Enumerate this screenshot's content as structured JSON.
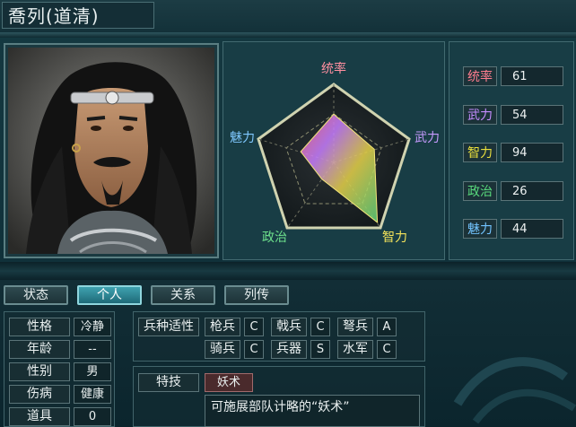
{
  "character": {
    "name": "喬列(道清)"
  },
  "radar": {
    "labels": {
      "command": "统率",
      "war": "武力",
      "intelligence": "智力",
      "politics": "政治",
      "charm": "魅力"
    },
    "colors": {
      "command": "#ff8fa0",
      "war": "#c79bff",
      "intelligence": "#f2e25a",
      "politics": "#6de08c",
      "charm": "#7fc8ff"
    }
  },
  "stats": [
    {
      "label": "统率",
      "value": "61",
      "color": "#ff7d8e"
    },
    {
      "label": "武力",
      "value": "54",
      "color": "#c58cff"
    },
    {
      "label": "智力",
      "value": "94",
      "color": "#eadf3c"
    },
    {
      "label": "政治",
      "value": "26",
      "color": "#58d97c"
    },
    {
      "label": "魅力",
      "value": "44",
      "color": "#72c4ff"
    }
  ],
  "tabs": [
    {
      "label": "状态",
      "active": false
    },
    {
      "label": "个人",
      "active": true
    },
    {
      "label": "关系",
      "active": false
    },
    {
      "label": "列传",
      "active": false
    }
  ],
  "personal": [
    {
      "label": "性格",
      "value": "冷静"
    },
    {
      "label": "年龄",
      "value": "--"
    },
    {
      "label": "性别",
      "value": "男"
    },
    {
      "label": "伤病",
      "value": "健康"
    },
    {
      "label": "道具",
      "value": "0"
    }
  ],
  "aptitude": {
    "header": "兵种适性",
    "rows": [
      [
        {
          "type": "枪兵",
          "grade": "C"
        },
        {
          "type": "戟兵",
          "grade": "C"
        },
        {
          "type": "弩兵",
          "grade": "A"
        }
      ],
      [
        {
          "type": "骑兵",
          "grade": "C"
        },
        {
          "type": "兵器",
          "grade": "S"
        },
        {
          "type": "水军",
          "grade": "C"
        }
      ]
    ]
  },
  "skill": {
    "label": "特技",
    "name": "妖术",
    "description": "可施展部队计略的“妖术”"
  }
}
